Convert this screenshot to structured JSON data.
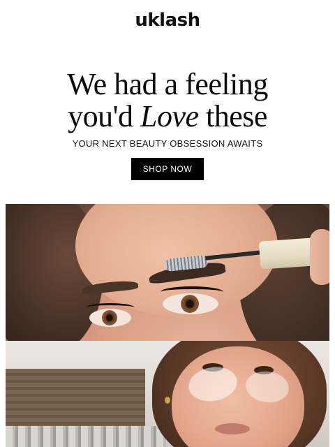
{
  "brand": {
    "logo_text": "uklash"
  },
  "hero": {
    "headline_line1": "We had a feeling",
    "headline_line2_prefix": "you'd",
    "headline_line2_emphasis": "Love",
    "headline_line2_suffix": "these",
    "subhead": "YOUR NEXT BEAUTY OBSESSION AWAITS",
    "cta_label": "SHOP NOW"
  },
  "colors": {
    "background": "#ffffff",
    "text": "#111111",
    "cta_background": "#000000",
    "cta_text": "#ffffff"
  }
}
